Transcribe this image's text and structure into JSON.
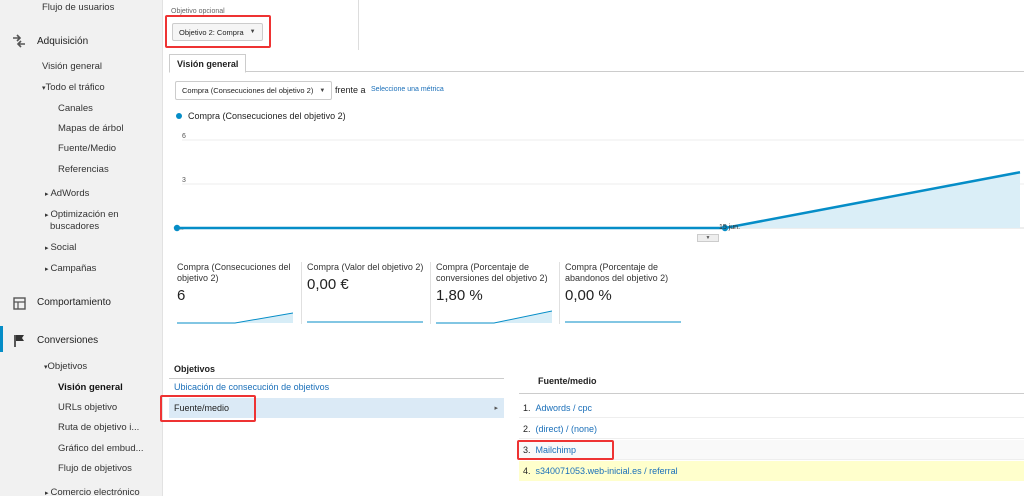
{
  "sidebar": {
    "top_item": "Flujo de usuarios",
    "acquisition": {
      "label": "Adquisición",
      "overview": "Visión general",
      "all_traffic": "Todo el tráfico",
      "all_traffic_items": [
        "Canales",
        "Mapas de árbol",
        "Fuente/Medio",
        "Referencias"
      ],
      "adwords": "AdWords",
      "seo_line1": "Optimización en",
      "seo_line2": "buscadores",
      "social": "Social",
      "campaigns": "Campañas"
    },
    "behavior": "Comportamiento",
    "conversions": {
      "label": "Conversiones",
      "goals": "Objetivos",
      "goal_items": [
        "Visión general",
        "URLs objetivo",
        "Ruta de objetivo i...",
        "Gráfico del embud...",
        "Flujo de objetivos"
      ],
      "ecommerce": "Comercio electrónico"
    }
  },
  "goal_selector": {
    "label": "Objetivo opcional",
    "value": "Objetivo 2: Compra"
  },
  "tab": "Visión general",
  "metric_selector": {
    "value": "Compra (Consecuciones del objetivo 2)",
    "versus": "frente a",
    "select_metric": "Seleccione una métrica"
  },
  "chart": {
    "legend": "Compra (Consecuciones del objetivo 2)",
    "date_label": "15 jun.",
    "left_label": "..."
  },
  "chart_data": {
    "type": "area",
    "series": [
      {
        "name": "Compra (Consecuciones del objetivo 2)",
        "values": [
          0,
          0,
          3.8
        ]
      }
    ],
    "x": [
      "",
      "15 jun.",
      ""
    ],
    "yticks": [
      "6",
      "3"
    ],
    "ylim": [
      0,
      6
    ],
    "color": "#058dc7"
  },
  "scorecards": [
    {
      "title": "Compra (Consecuciones del objetivo 2)",
      "value": "6"
    },
    {
      "title": "Compra (Valor del objetivo 2)",
      "value": "0,00 €"
    },
    {
      "title": "Compra (Porcentaje de conversiones del objetivo 2)",
      "value": "1,80 %"
    },
    {
      "title": "Compra (Porcentaje de abandonos del objetivo 2)",
      "value": "0,00 %"
    }
  ],
  "goals_panel": {
    "heading": "Objetivos",
    "link": "Ubicación de consecución de objetivos",
    "selected": "Fuente/medio",
    "arrow": "▸"
  },
  "source_table": {
    "heading": "Fuente/medio",
    "rows": [
      {
        "num": "1.",
        "label": "Adwords / cpc"
      },
      {
        "num": "2.",
        "label": "(direct) / (none)"
      },
      {
        "num": "3.",
        "label": "Mailchimp"
      },
      {
        "num": "4.",
        "label": "s340071053.web-inicial.es / referral"
      }
    ]
  },
  "colors": {
    "accent": "#058dc7",
    "highlight_red": "#e33",
    "link": "#1a6fb9"
  }
}
